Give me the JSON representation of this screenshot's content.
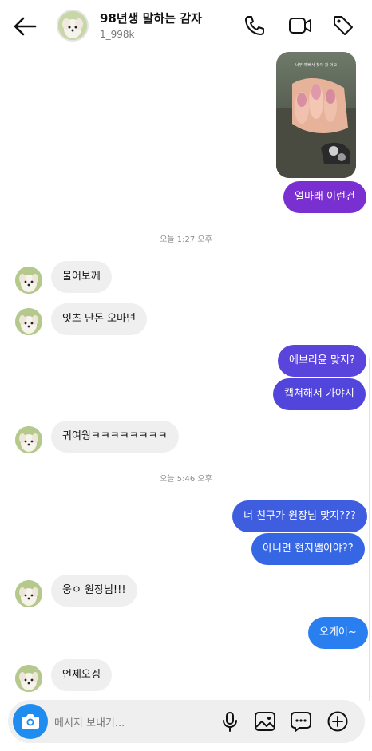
{
  "header": {
    "name": "98년생 말하는 감자",
    "username": "1_998k",
    "icons": [
      "back-arrow-icon",
      "phone-icon",
      "video-icon",
      "tag-icon"
    ]
  },
  "photo": {
    "caption": "너무 예뻐서 찾아 왔 어요"
  },
  "messages": {
    "m1": "얼마래 이런건",
    "ts1": "오늘 1:27 오후",
    "m2": "물어보께",
    "m3": "잇츠 단돈 오마넌",
    "m4": "에브리윤 맞지?",
    "m5": "캡쳐해서 가야지",
    "m6": "귀여웡ㅋㅋㅋㅋㅋㅋㅋㅋ",
    "ts2": "오늘 5:46 오후",
    "m7": "너 친구가 원장님 맞지???",
    "m8": "아니면 현지쌤이야??",
    "m9": "웅ㅇ 원장님!!!",
    "m10": "오케이~",
    "m11": "언제오겡"
  },
  "composer": {
    "placeholder": "메시지 보내기...",
    "icons": [
      "camera-icon",
      "microphone-icon",
      "gallery-icon",
      "sticker-icon",
      "plus-icon"
    ]
  },
  "colors": {
    "purple": "#7a2fd0",
    "violet": "#5a45dc",
    "indigo": "#4157dd",
    "blue": "#2f6ee8",
    "sky": "#2a7ff0",
    "received": "#efefef"
  }
}
